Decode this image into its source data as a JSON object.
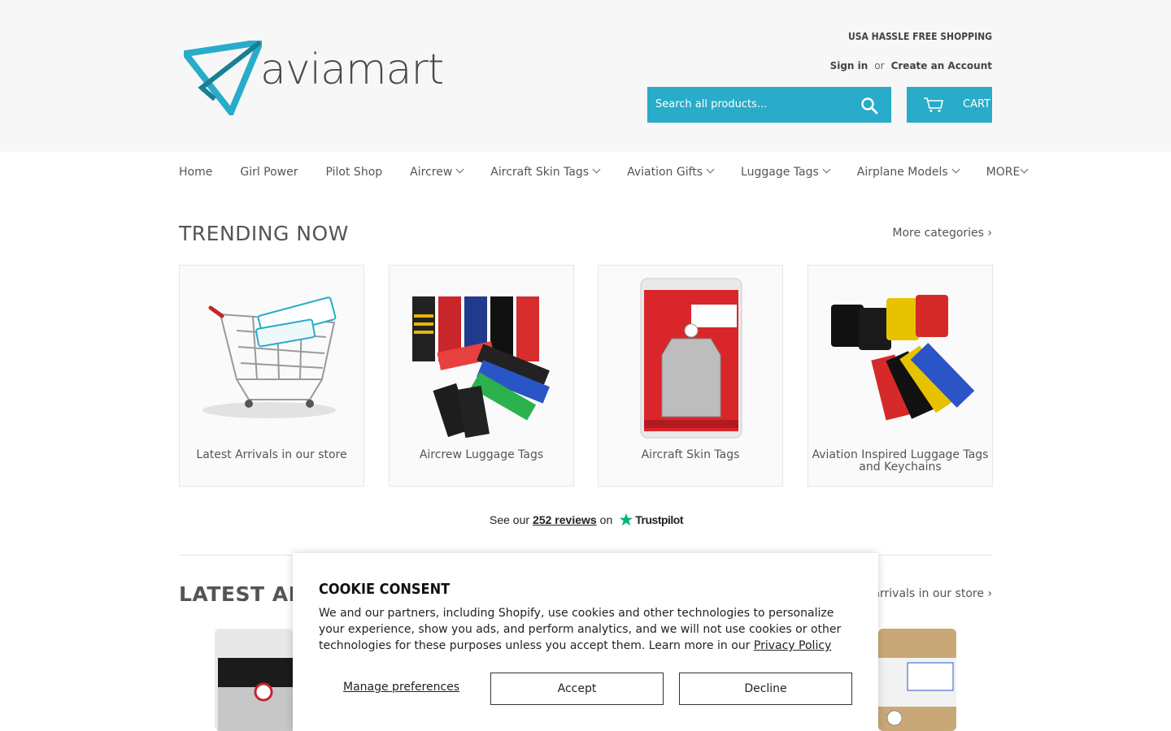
{
  "header": {
    "logo_text": "aviamart",
    "tagline": "USA HASSLE FREE SHOPPING",
    "sign_in": "Sign in",
    "or": "or",
    "create_account": "Create an Account",
    "search_placeholder": "Search all products...",
    "cart_label": "CART",
    "accent_color": "#28acc9"
  },
  "nav": {
    "items": [
      {
        "label": "Home",
        "dropdown": false
      },
      {
        "label": "Girl Power",
        "dropdown": false
      },
      {
        "label": "Pilot Shop",
        "dropdown": false
      },
      {
        "label": "Aircrew",
        "dropdown": true
      },
      {
        "label": "Aircraft Skin Tags",
        "dropdown": true
      },
      {
        "label": "Aviation Gifts",
        "dropdown": true
      },
      {
        "label": "Luggage Tags",
        "dropdown": true
      },
      {
        "label": "Airplane Models",
        "dropdown": true
      },
      {
        "label": "MORE",
        "dropdown": true
      }
    ]
  },
  "trending": {
    "title": "TRENDING NOW",
    "more_link": "More categories ›",
    "cards": [
      {
        "caption": "Latest Arrivals in our store",
        "icon": "shopping-cart-image"
      },
      {
        "caption": "Aircrew Luggage Tags",
        "icon": "crew-tags-image"
      },
      {
        "caption": "Aircraft Skin Tags",
        "icon": "skin-tag-image"
      },
      {
        "caption": "Aviation Inspired Luggage Tags and Keychains",
        "icon": "keychains-image"
      }
    ]
  },
  "trustpilot": {
    "prefix": "See our",
    "count": "252 reviews",
    "on": "on",
    "brand": "Trustpilot"
  },
  "latest": {
    "title": "LATEST ARRI",
    "link": "t arrivals in our store ›"
  },
  "cookie": {
    "title": "COOKIE CONSENT",
    "body": "We and our partners, including Shopify, use cookies and other technologies to personalize your experience, show you ads, and perform analytics, and we will not use cookies or other technologies for these purposes unless you accept them. Learn more in our ",
    "privacy_link": "Privacy Policy",
    "manage": "Manage preferences",
    "accept": "Accept",
    "decline": "Decline"
  }
}
